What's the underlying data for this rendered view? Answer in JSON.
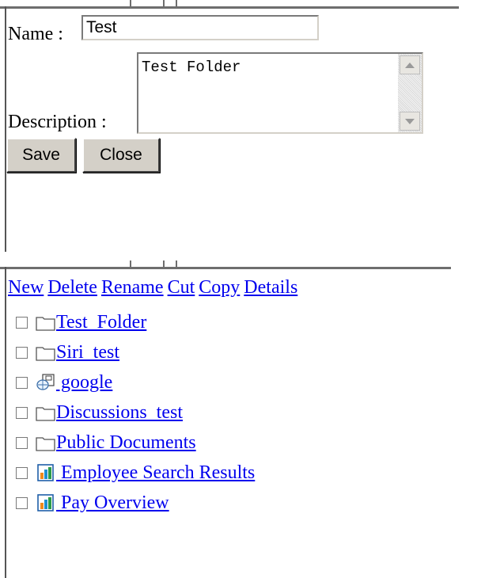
{
  "edit_form": {
    "name_label": "Name :",
    "name_value": "Test",
    "description_label": "Description :",
    "description_value": "Test Folder",
    "save_label": "Save",
    "close_label": "Close"
  },
  "folder_panel": {
    "actions": [
      "New",
      "Delete",
      "Rename",
      "Cut",
      "Copy",
      "Details"
    ],
    "items": [
      {
        "label": "Test  Folder",
        "icon": "folder-icon"
      },
      {
        "label": "Siri  test",
        "icon": "folder-icon"
      },
      {
        "label": " google",
        "icon": "web-link-icon"
      },
      {
        "label": "Discussions  test",
        "icon": "folder-icon"
      },
      {
        "label": "Public Documents",
        "icon": "folder-icon"
      },
      {
        "label": " Employee Search Results",
        "icon": "report-icon"
      },
      {
        "label": " Pay Overview",
        "icon": "report-icon"
      }
    ]
  }
}
